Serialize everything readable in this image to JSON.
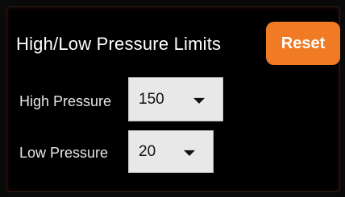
{
  "title": "High/Low Pressure Limits",
  "reset_label": "Reset",
  "high": {
    "label": "High Pressure",
    "value": "150"
  },
  "low": {
    "label": "Low Pressure",
    "value": "20"
  },
  "colors": {
    "accent": "#f07b24",
    "background": "#000000",
    "dropdown_bg": "#e8e8e8"
  }
}
